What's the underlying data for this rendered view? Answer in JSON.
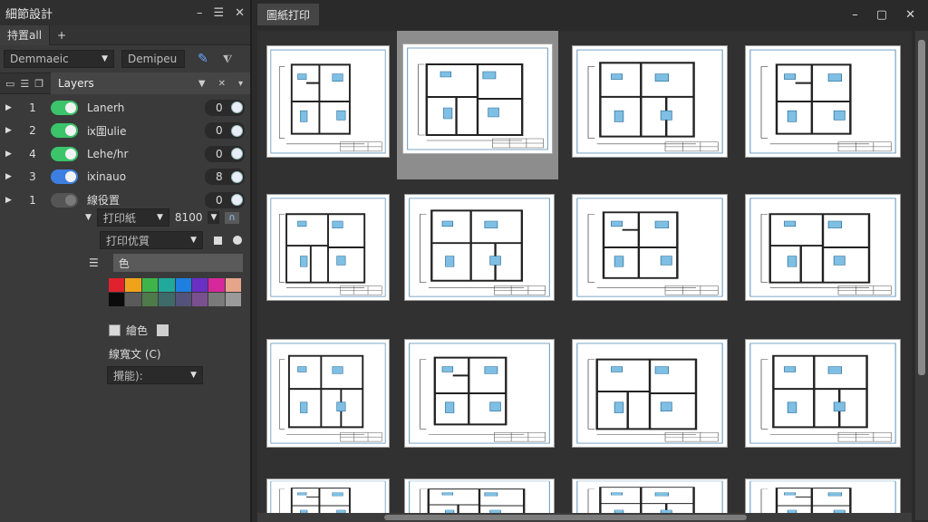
{
  "left_panel": {
    "title": "細節設計",
    "title_controls": [
      "–",
      "☰",
      "✕"
    ],
    "tabs": [
      "持置all",
      "+"
    ],
    "dropdown1": "Demmaeic",
    "dropdown2": "Demipeu",
    "layers_header": "Layers",
    "layers": [
      {
        "num": "1",
        "name": "Lanerh",
        "on": true,
        "color": "#3cc46b",
        "value": "0"
      },
      {
        "num": "2",
        "name": "ⅸ圍ulie",
        "on": true,
        "color": "#3cc46b",
        "value": "0"
      },
      {
        "num": "4",
        "name": "Lehe/hr",
        "on": true,
        "color": "#3cc46b",
        "value": "0"
      },
      {
        "num": "3",
        "name": "ⅸinauo",
        "on": true,
        "color": "#3d7fe0",
        "value": "8"
      },
      {
        "num": "1",
        "name": "線役置",
        "on": false,
        "color": "#555555",
        "value": "0"
      }
    ],
    "print_style_label": "打印紙",
    "print_style_value": "8100",
    "print_opt_label": "打印优質",
    "color_label": "色",
    "swatch_colors": [
      "#e0222e",
      "#f0a31a",
      "#3fb44b",
      "#21a99b",
      "#1e7fe0",
      "#6a2fc4",
      "#d6289a",
      "#e6a58a",
      "#0b0b0b",
      "#5a5a5a",
      "#4f7a4a",
      "#3e6a6a",
      "#52527a",
      "#7a4f8f",
      "#7a7a7a",
      "#9a9a9a"
    ],
    "checkbox_label": "繪色",
    "line_label": "線寬文 (C)",
    "bottom_dropdown": "攪能):"
  },
  "right_panel": {
    "tab": "圖紙打印",
    "controls": [
      "–",
      "▢",
      "✕"
    ]
  }
}
